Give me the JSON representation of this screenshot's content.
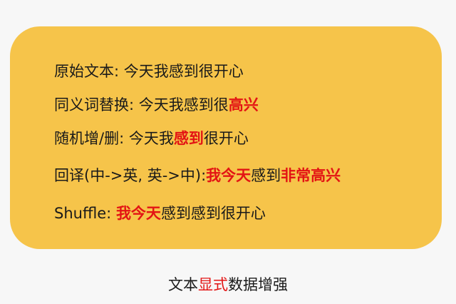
{
  "lines": [
    {
      "label": "原始文本: ",
      "segments": [
        {
          "text": "今天我感到很开心",
          "highlight": false
        }
      ]
    },
    {
      "label": "同义词替换: ",
      "segments": [
        {
          "text": "今天我感到很",
          "highlight": false
        },
        {
          "text": "高兴",
          "highlight": true
        }
      ]
    },
    {
      "label": "随机增/删: ",
      "segments": [
        {
          "text": "今天我",
          "highlight": false
        },
        {
          "text": "感到",
          "highlight": true
        },
        {
          "text": "很开心",
          "highlight": false
        }
      ]
    },
    {
      "label": "回译(中->英, 英->中):",
      "segments": [
        {
          "text": "我今天",
          "highlight": true
        },
        {
          "text": "感到",
          "highlight": false
        },
        {
          "text": "非常高兴",
          "highlight": true
        }
      ]
    },
    {
      "label": "Shuffle: ",
      "segments": [
        {
          "text": "我今天",
          "highlight": true
        },
        {
          "text": "感到感到很开心",
          "highlight": false
        }
      ]
    }
  ],
  "caption": {
    "before": "文本",
    "highlight": "显式",
    "after": "数据增强"
  },
  "colors": {
    "card": "#f6c44a",
    "highlight": "#e31414",
    "text": "#1a1a1a"
  }
}
